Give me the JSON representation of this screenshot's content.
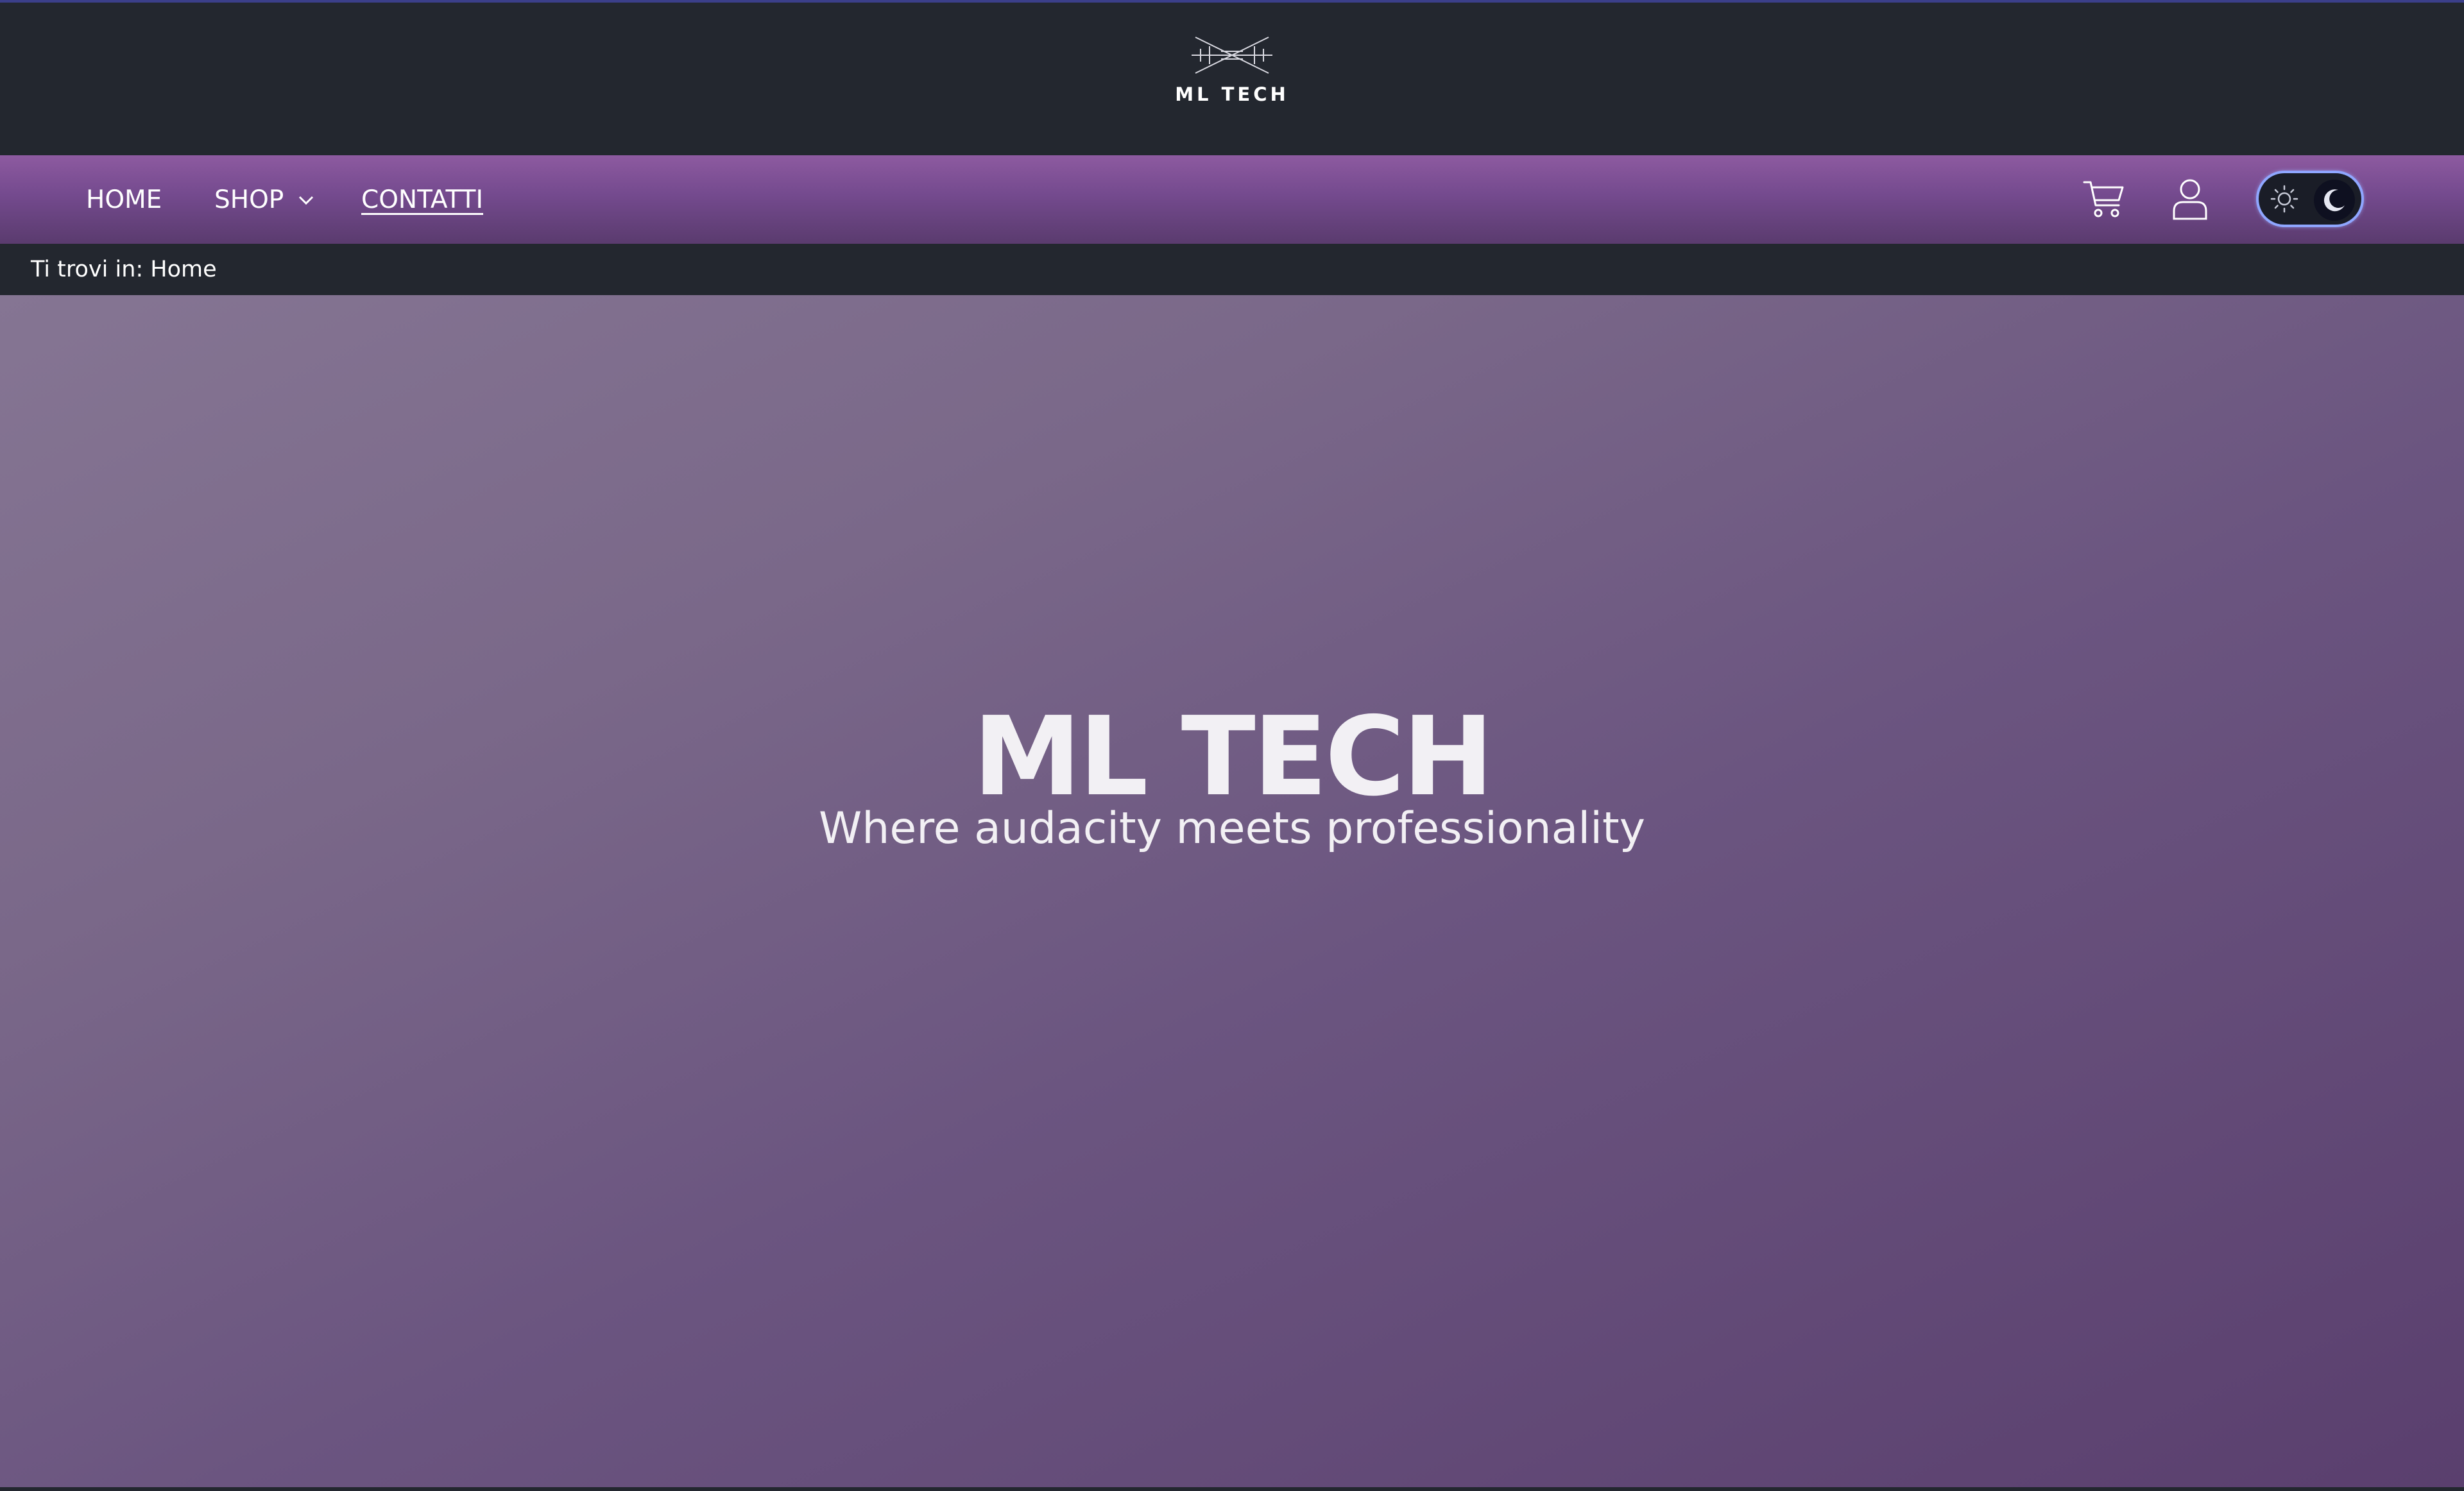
{
  "brand": {
    "logo_text": "ML TECH"
  },
  "nav": {
    "items": [
      {
        "label": "HOME"
      },
      {
        "label": "SHOP"
      },
      {
        "label": "CONTATTI"
      }
    ],
    "cart_icon": "cart-icon",
    "user_icon": "user-icon",
    "theme_toggle": {
      "light_icon": "sun-icon",
      "dark_icon": "moon-icon",
      "state": "dark"
    }
  },
  "breadcrumb": {
    "text": "Ti trovi in: Home"
  },
  "hero": {
    "title": "ML TECH",
    "subtitle": "Where audacity meets professionality"
  },
  "colors": {
    "header_bg": "#23272f",
    "nav_purple": "#744a8e",
    "hero_start": "#857593",
    "hero_end": "#5a3f6e",
    "toggle_border": "#8fa6ff"
  }
}
